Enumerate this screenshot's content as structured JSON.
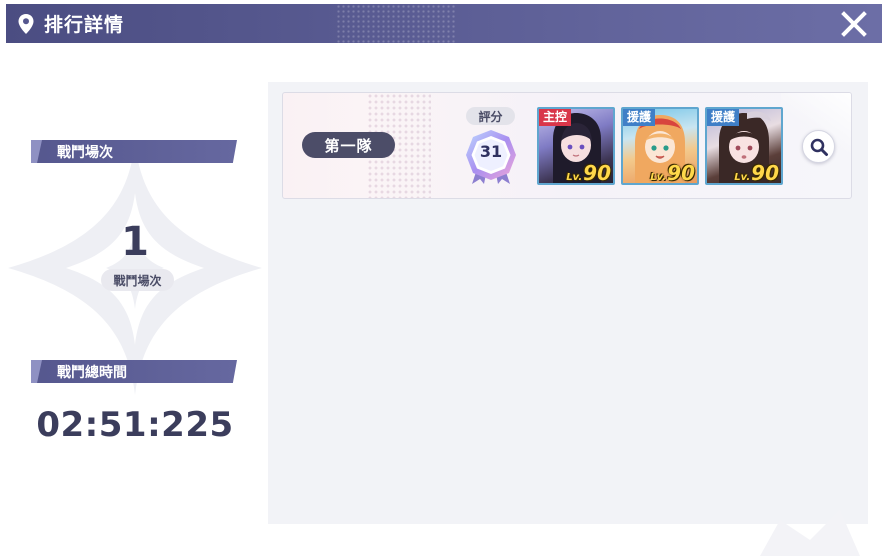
{
  "header": {
    "title": "排行詳情",
    "icons": {
      "location": "location-pin-icon",
      "close": "close-icon"
    }
  },
  "stats": {
    "battle_count_label": "戰鬥場次",
    "battle_count_value": "1",
    "battle_count_caption": "戰鬥場次",
    "battle_time_label": "戰鬥總時間",
    "battle_time_value": "02:51:225"
  },
  "team": {
    "name": "第一隊",
    "score_label": "評分",
    "score_value": "31",
    "characters": [
      {
        "role": "主控",
        "level": "90",
        "lv_prefix": "Lv."
      },
      {
        "role": "援護",
        "level": "90",
        "lv_prefix": "Lv."
      },
      {
        "role": "援護",
        "level": "90",
        "lv_prefix": "Lv."
      }
    ]
  },
  "colors": {
    "header": "#55578e",
    "accent_dark": "#3b3d5c",
    "tag_main": "#d9364a",
    "tag_support": "#3f7fc7",
    "level_gold": "#ffd84a"
  }
}
